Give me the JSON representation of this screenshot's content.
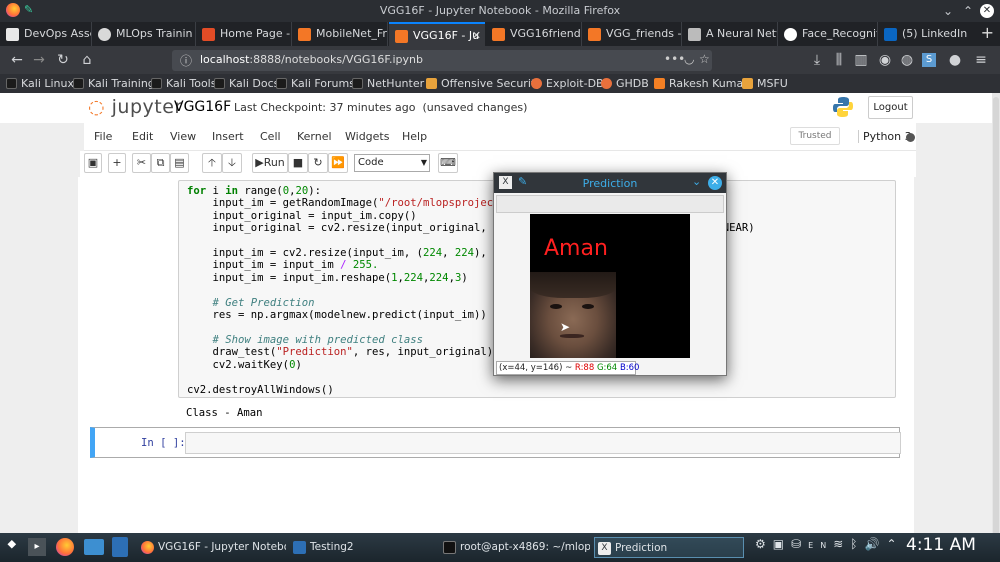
{
  "window_title": "VGG16F - Jupyter Notebook - Mozilla Firefox",
  "tabs": [
    {
      "label": "DevOps Assem",
      "color": "#e8e8e8"
    },
    {
      "label": "MLOps Trainin",
      "color": "#d9d9d9"
    },
    {
      "label": "Home Page - S",
      "color": "#e34c26"
    },
    {
      "label": "MobileNet_Frie",
      "color": "#f37726"
    },
    {
      "label": "VGG16F - Ju",
      "color": "#f37726"
    },
    {
      "label": "VGG16friends",
      "color": "#f37726"
    },
    {
      "label": "VGG_friends - J",
      "color": "#f37726"
    },
    {
      "label": "A Neural Netw",
      "color": "#bbbbbb"
    },
    {
      "label": "Face_Recogniti",
      "color": "#ffffff"
    },
    {
      "label": "(5) LinkedIn",
      "color": "#0a66c2"
    }
  ],
  "url": {
    "host": "localhost",
    "rest": ":8888/notebooks/VGG16F.ipynb",
    "more": "•••"
  },
  "bookmarks": [
    "Kali Linux",
    "Kali Training",
    "Kali Tools",
    "Kali Docs",
    "Kali Forums",
    "NetHunter",
    "Offensive Security",
    "Exploit-DB",
    "GHDB",
    "Rakesh Kumar",
    "MSFU"
  ],
  "jupyter": {
    "logo": "jupyter",
    "notebook_name": "VGG16F",
    "checkpoint": "Last Checkpoint: 37 minutes ago",
    "unsaved": "(unsaved changes)",
    "logout": "Logout",
    "menu": [
      "File",
      "Edit",
      "View",
      "Insert",
      "Cell",
      "Kernel",
      "Widgets",
      "Help"
    ],
    "trusted": "Trusted",
    "kernel": "Python 3",
    "run_label": "Run",
    "cell_type": "Code"
  },
  "output_text": "Class - Aman",
  "empty_prompt": "In [ ]:",
  "prediction_window": {
    "title": "Prediction",
    "label": "Aman",
    "status": {
      "coord": "(x=44, y=146) ~",
      "r": "R:88",
      "g": "G:64",
      "b": "B:60"
    }
  },
  "taskbar": {
    "items": [
      "VGG16F - Jupyter Noteboo...",
      "Testing2",
      "root@apt-x4869: ~/mlopsp...",
      "Prediction"
    ],
    "lang": "EN",
    "clock": "4:11 AM"
  },
  "colors": {
    "jupyter_orange": "#f37726",
    "kde_blue": "#3daee9",
    "prompt_blue": "#303f9f",
    "cell_border_blue": "#42a5f5"
  }
}
